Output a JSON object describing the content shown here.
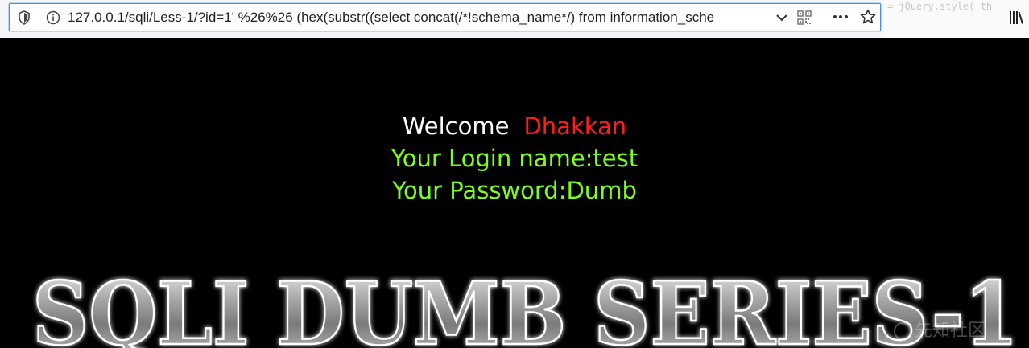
{
  "browser": {
    "url": "127.0.0.1/sqli/Less-1/?id=1' %26%26 (hex(substr((select concat(/*!schema_name*/) from information_sche",
    "devtools_snippet": "= jQuery.style( th",
    "icons": {
      "shield": "tracking-shield-icon",
      "info": "site-info-icon",
      "dropdown": "chevron-down-icon",
      "qr": "qr-code-icon",
      "more": "more-actions-icon",
      "bookmark": "bookmark-star-icon",
      "library": "library-icon"
    },
    "accent_color": "#4a90d9"
  },
  "page": {
    "welcome_label": "Welcome",
    "welcome_name": "Dhakkan",
    "login_name": "Your Login name:test",
    "password": "Your Password:Dumb",
    "banner_title": "SQLI DUMB SERIES-1",
    "watermark": "先知社区",
    "colors": {
      "background": "#000000",
      "welcome": "#ffffff",
      "name": "#ff1c1c",
      "info": "#7dff1a"
    }
  }
}
